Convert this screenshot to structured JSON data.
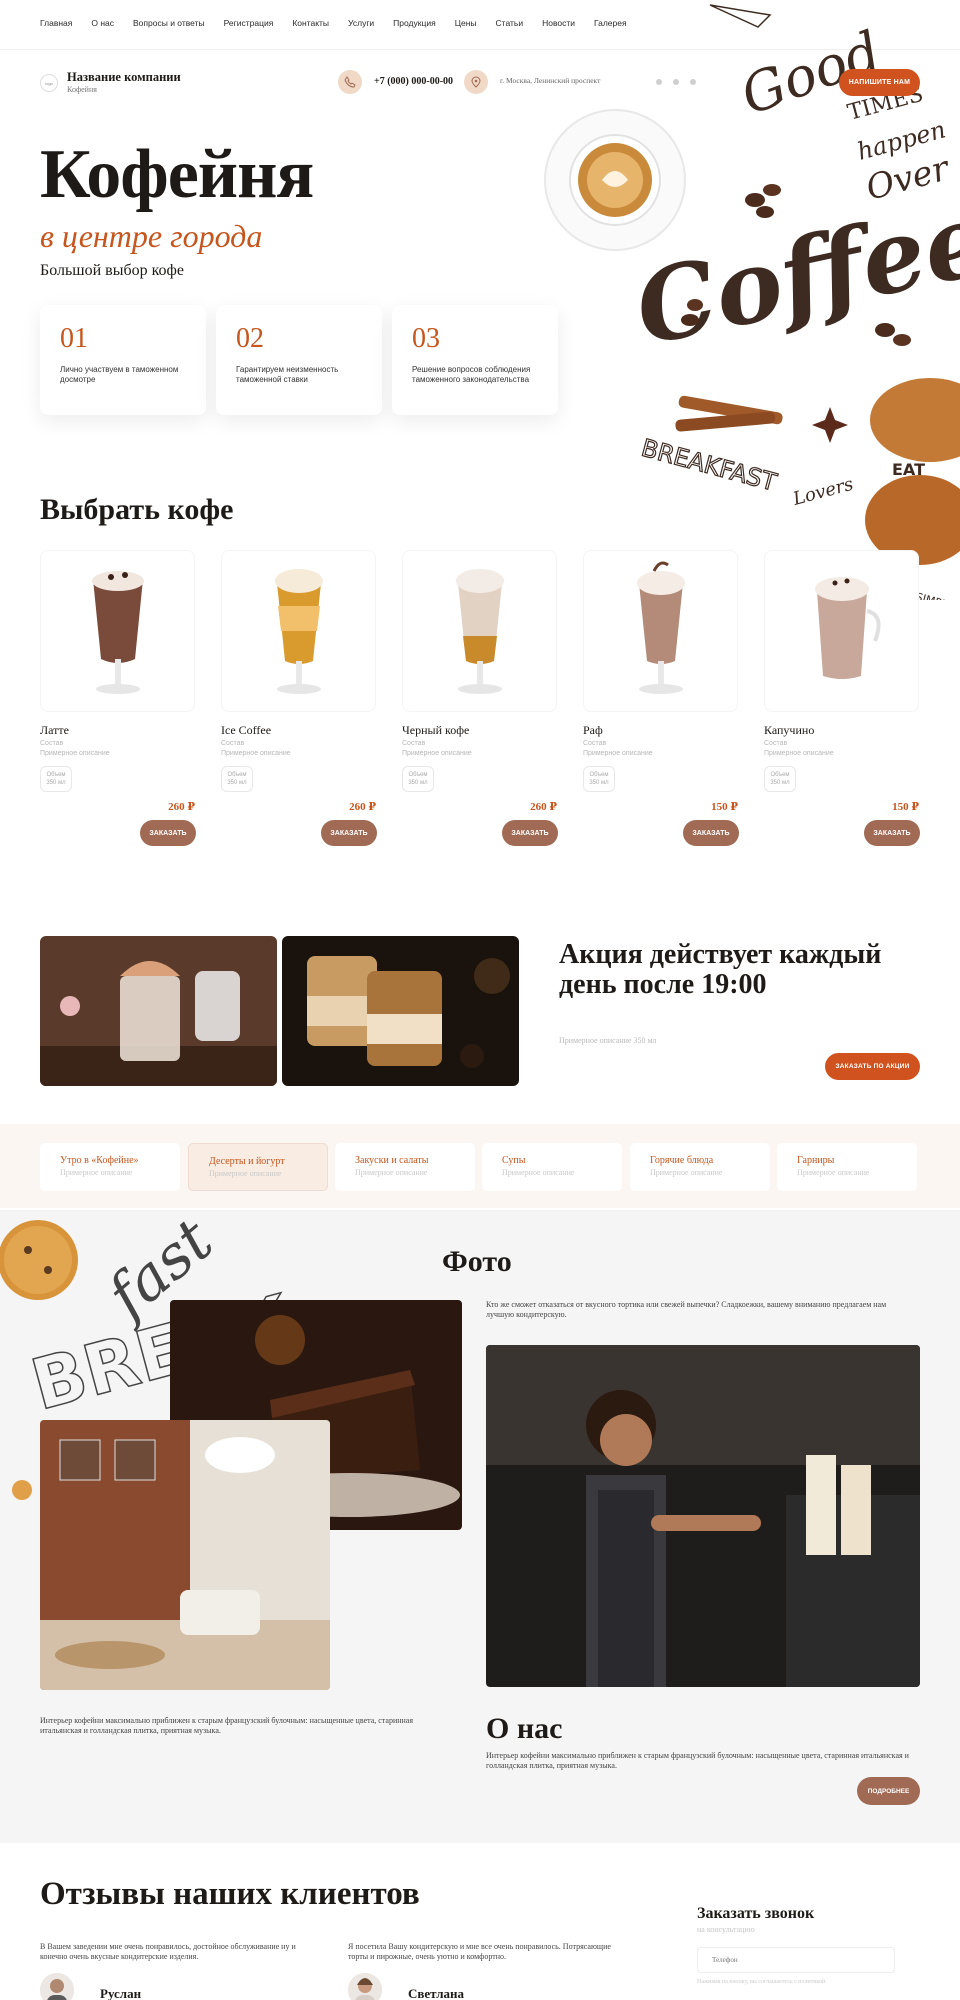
{
  "nav": {
    "items": [
      "Главная",
      "О нас",
      "Вопросы и ответы",
      "Регистрация",
      "Контакты",
      "Услуги",
      "Продукция",
      "Цены",
      "Статьи",
      "Новости",
      "Галерея"
    ]
  },
  "header": {
    "company_name": "Название компании",
    "company_sub": "Кофейня",
    "phone": "+7 (000) 000-00-00",
    "address": "г. Москва, Ленинский проспект",
    "cta": "НАПИШИТЕ НАМ"
  },
  "hero": {
    "title": "Кофейня",
    "subtitle": "в центре города",
    "tagline": "Большой выбор кофе",
    "features": [
      {
        "num": "01",
        "text": "Лично участвуем в таможенном досмотре"
      },
      {
        "num": "02",
        "text": "Гарантируем неизменность таможенной ставки"
      },
      {
        "num": "03",
        "text": "Решение вопросов соблюдения таможенного законодательства"
      }
    ]
  },
  "menu": {
    "title": "Выбрать кофе",
    "items": [
      {
        "name": "Латте",
        "label": "Состав",
        "desc": "Примерное описание",
        "vol_label": "Объем",
        "vol": "350 мл",
        "price": "260 ₽",
        "button": "ЗАКАЗАТЬ"
      },
      {
        "name": "Ice Coffee",
        "label": "Состав",
        "desc": "Примерное описание",
        "vol_label": "Объем",
        "vol": "350 мл",
        "price": "260 ₽",
        "button": "ЗАКАЗАТЬ"
      },
      {
        "name": "Черный кофе",
        "label": "Состав",
        "desc": "Примерное описание",
        "vol_label": "Объем",
        "vol": "350 мл",
        "price": "260 ₽",
        "button": "ЗАКАЗАТЬ"
      },
      {
        "name": "Раф",
        "label": "Состав",
        "desc": "Примерное описание",
        "vol_label": "Объем",
        "vol": "350 мл",
        "price": "150 ₽",
        "button": "ЗАКАЗАТЬ"
      },
      {
        "name": "Капучино",
        "label": "Состав",
        "desc": "Примерное описание",
        "vol_label": "Объем",
        "vol": "350 мл",
        "price": "150 ₽",
        "button": "ЗАКАЗАТЬ"
      }
    ]
  },
  "promo": {
    "title": "Акция действует каждый день после 19:00",
    "desc": "Примерное описание 350 мл",
    "button": "ЗАКАЗАТЬ ПО АКЦИИ"
  },
  "categories": [
    {
      "name": "Утро в «Кофейне»",
      "desc": "Примерное описание"
    },
    {
      "name": "Десерты и йогурт",
      "desc": "Примерное описание"
    },
    {
      "name": "Закуски и салаты",
      "desc": "Примерное описание"
    },
    {
      "name": "Супы",
      "desc": "Примерное описание"
    },
    {
      "name": "Горячие блюда",
      "desc": "Примерное описание"
    },
    {
      "name": "Гарниры",
      "desc": "Примерное описание"
    }
  ],
  "gallery": {
    "title": "Фото",
    "intro": "Кто же сможет отказаться от вкусного тортика или свежей выпечки? Сладкоежки, вашему вниманию предлагаем нам лучшую кондитерскую.",
    "caption": "Интерьер кофейни максимально приближен к старым французский булочным: насыщенные цвета, старинная итальянская и голландская плитка, приятная музыка."
  },
  "about": {
    "title": "О нас",
    "text": "Интерьер кофейни максимально приближен к старым французский булочным: насыщенные цвета, старинная итальянская и голландская плитка, приятная музыка.",
    "button": "ПОДРОБНЕЕ"
  },
  "reviews": {
    "title": "Отзывы наших клиентов",
    "items": [
      {
        "text": "В Вашем заведении мне очень понравилось, достойное обслуживание ну и конечно очень вкусные кондитерские изделия.",
        "name": "Руслан"
      },
      {
        "text": "Я посетила Вашу кондитерскую и мне все очень понравилось. Потрясающие торты и пирожные, очень уютно и комфортно.",
        "name": "Светлана"
      }
    ]
  },
  "callback": {
    "title": "Заказать звонок",
    "sub": "на консультацию",
    "placeholder": "Телефон",
    "note": "Нажимая на кнопку, вы соглашаетесь с политикой"
  },
  "art": {
    "words": [
      "Good",
      "TIMES",
      "happen",
      "Over",
      "Coffee",
      "BREAKFAST",
      "Lovers",
      "EAT",
      "SIMPLE TH"
    ]
  },
  "colors": {
    "accent": "#d0531f",
    "brown": "#a06a55",
    "accent_text": "#c6561e"
  }
}
